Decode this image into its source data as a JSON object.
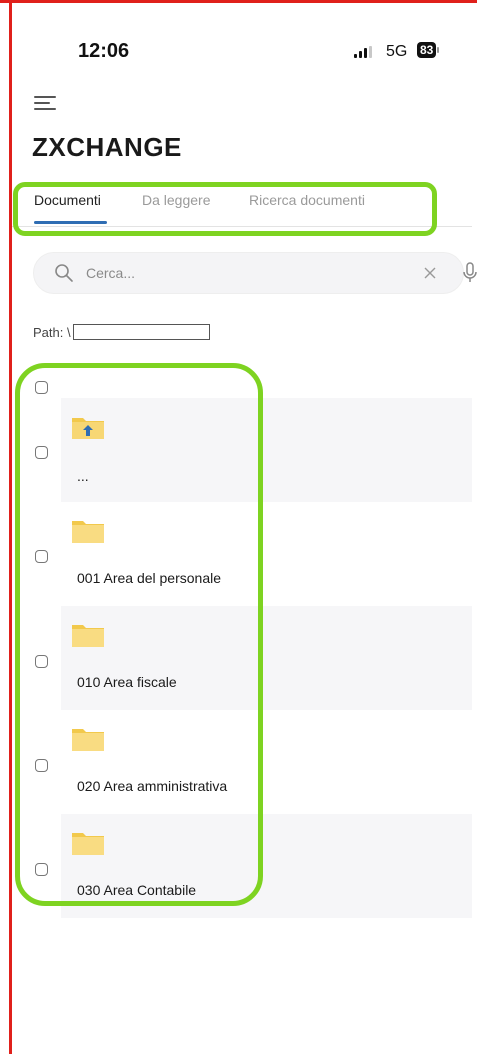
{
  "status_bar": {
    "time": "12:06",
    "network": "5G",
    "battery": "83"
  },
  "header": {
    "menu_icon": "hamburger-menu-icon",
    "title": "ZXCHANGE"
  },
  "tabs": [
    {
      "label": "Documenti",
      "active": true
    },
    {
      "label": "Da leggere",
      "active": false
    },
    {
      "label": "Ricerca documenti",
      "active": false
    }
  ],
  "search": {
    "placeholder": "Cerca...",
    "value": "",
    "icons": [
      "search-icon",
      "clear-icon",
      "microphone-icon"
    ]
  },
  "path": {
    "label": "Path: \\"
  },
  "list": {
    "items": [
      {
        "label": "...",
        "icon": "folder-up-icon"
      },
      {
        "label": "001 Area del personale",
        "icon": "folder-icon"
      },
      {
        "label": "010 Area fiscale",
        "icon": "folder-icon"
      },
      {
        "label": "020 Area amministrativa",
        "icon": "folder-icon"
      },
      {
        "label": "030 Area Contabile",
        "icon": "folder-icon"
      }
    ]
  },
  "colors": {
    "accent": "#2f6db3",
    "highlight": "#7ed321",
    "frame": "#e0201b",
    "folder": "#f7d774"
  }
}
